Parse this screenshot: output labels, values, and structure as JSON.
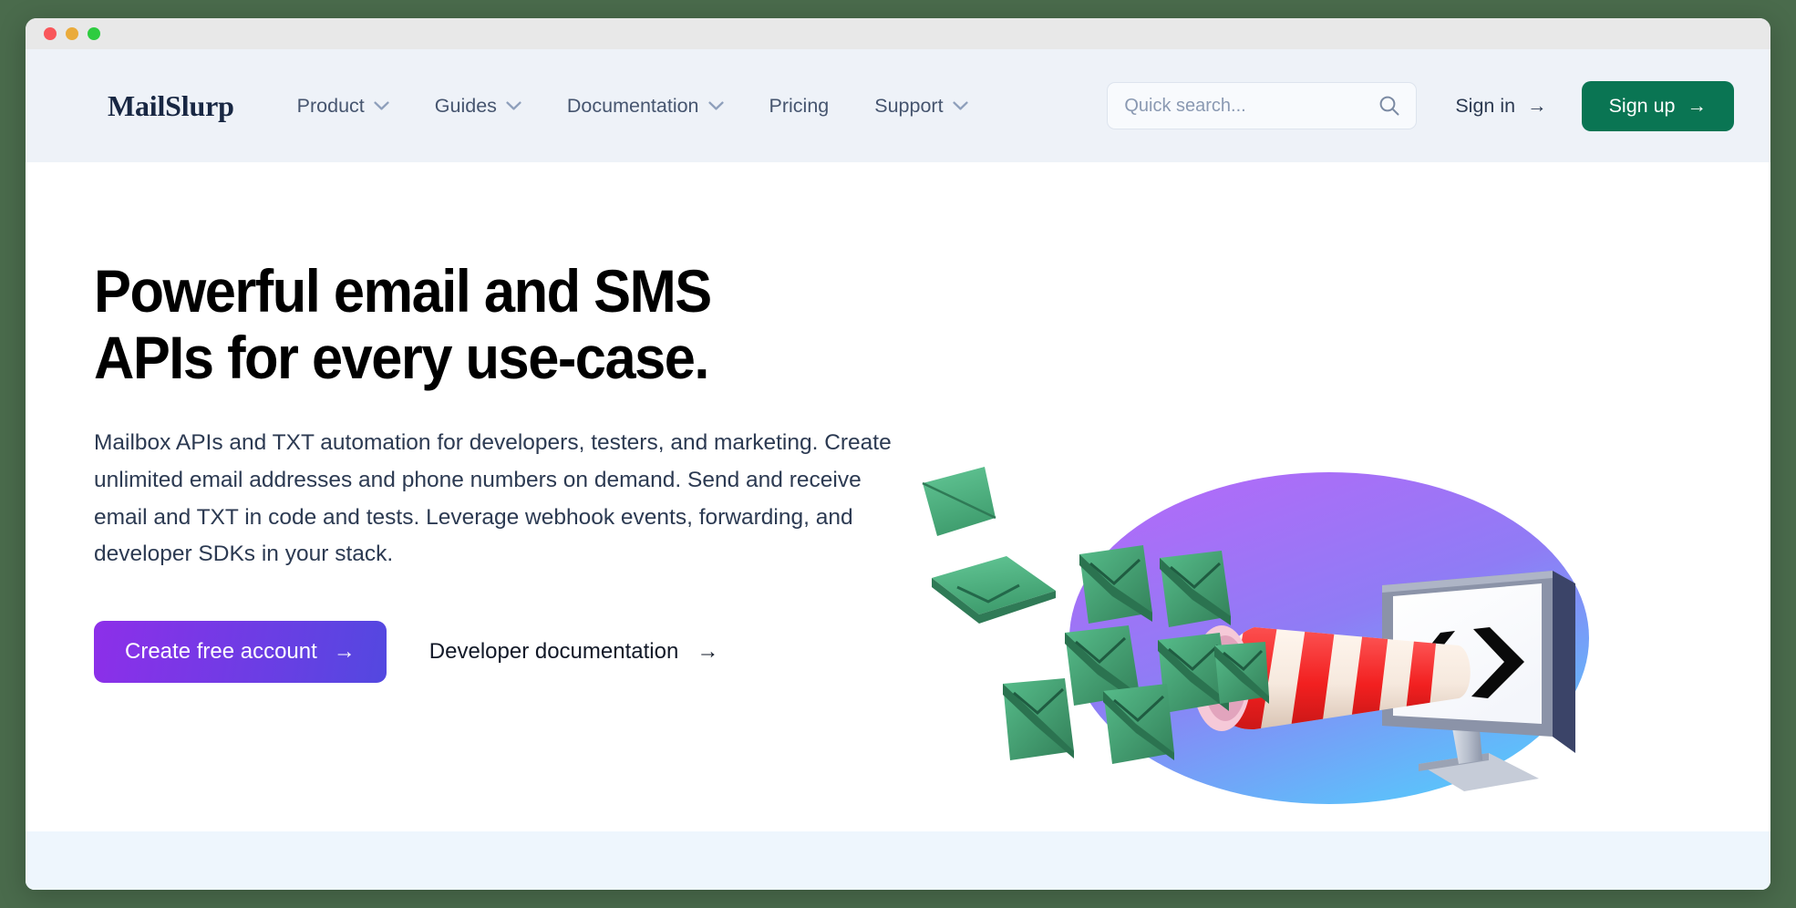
{
  "window": {
    "traffic_lights": [
      "close",
      "minimize",
      "maximize"
    ]
  },
  "nav": {
    "logo": "MailSlurp",
    "items": [
      {
        "label": "Product",
        "has_dropdown": true
      },
      {
        "label": "Guides",
        "has_dropdown": true
      },
      {
        "label": "Documentation",
        "has_dropdown": true
      },
      {
        "label": "Pricing",
        "has_dropdown": false
      },
      {
        "label": "Support",
        "has_dropdown": true
      }
    ],
    "search": {
      "placeholder": "Quick search...",
      "value": "",
      "icon": "search-icon"
    },
    "sign_in": "Sign in",
    "sign_up": "Sign up",
    "arrow_glyph": "→"
  },
  "hero": {
    "title": "Powerful email and SMS\nAPIs for every use-case.",
    "subtitle": "Mailbox APIs and TXT automation for developers, testers, and marketing. Create unlimited email addresses and phone numbers on demand. Send and receive email and TXT in code and tests. Leverage webhook events, forwarding, and developer SDKs in your stack.",
    "primary_cta": "Create free account",
    "secondary_cta": "Developer documentation",
    "arrow_glyph": "→",
    "illustration": "email-rocket-monitor-illustration"
  },
  "colors": {
    "desktop_background": "#4a6b4c",
    "titlebar": "#e8e8e8",
    "navbar_background": "#eef2f8",
    "logo_text": "#182743",
    "nav_link_text": "#46556f",
    "chevron": "#8fa0bc",
    "signup_green": "#0a7553",
    "cta_gradient_start": "#8d2fe9",
    "cta_gradient_end": "#5348e0",
    "heading_text": "#000000",
    "body_text": "#2c3a52",
    "bottom_band": "#eef6fd",
    "traffic_red": "#f9565a",
    "traffic_amber": "#eaab3b",
    "traffic_green": "#2ecc40",
    "illustration_blob_start": "#a855f7",
    "illustration_blob_end": "#5bc8fb",
    "envelope_green": "#4caf7d",
    "cone_red": "#f43b3b",
    "monitor_frame": "#8b93a8",
    "monitor_side": "#3b4468"
  }
}
